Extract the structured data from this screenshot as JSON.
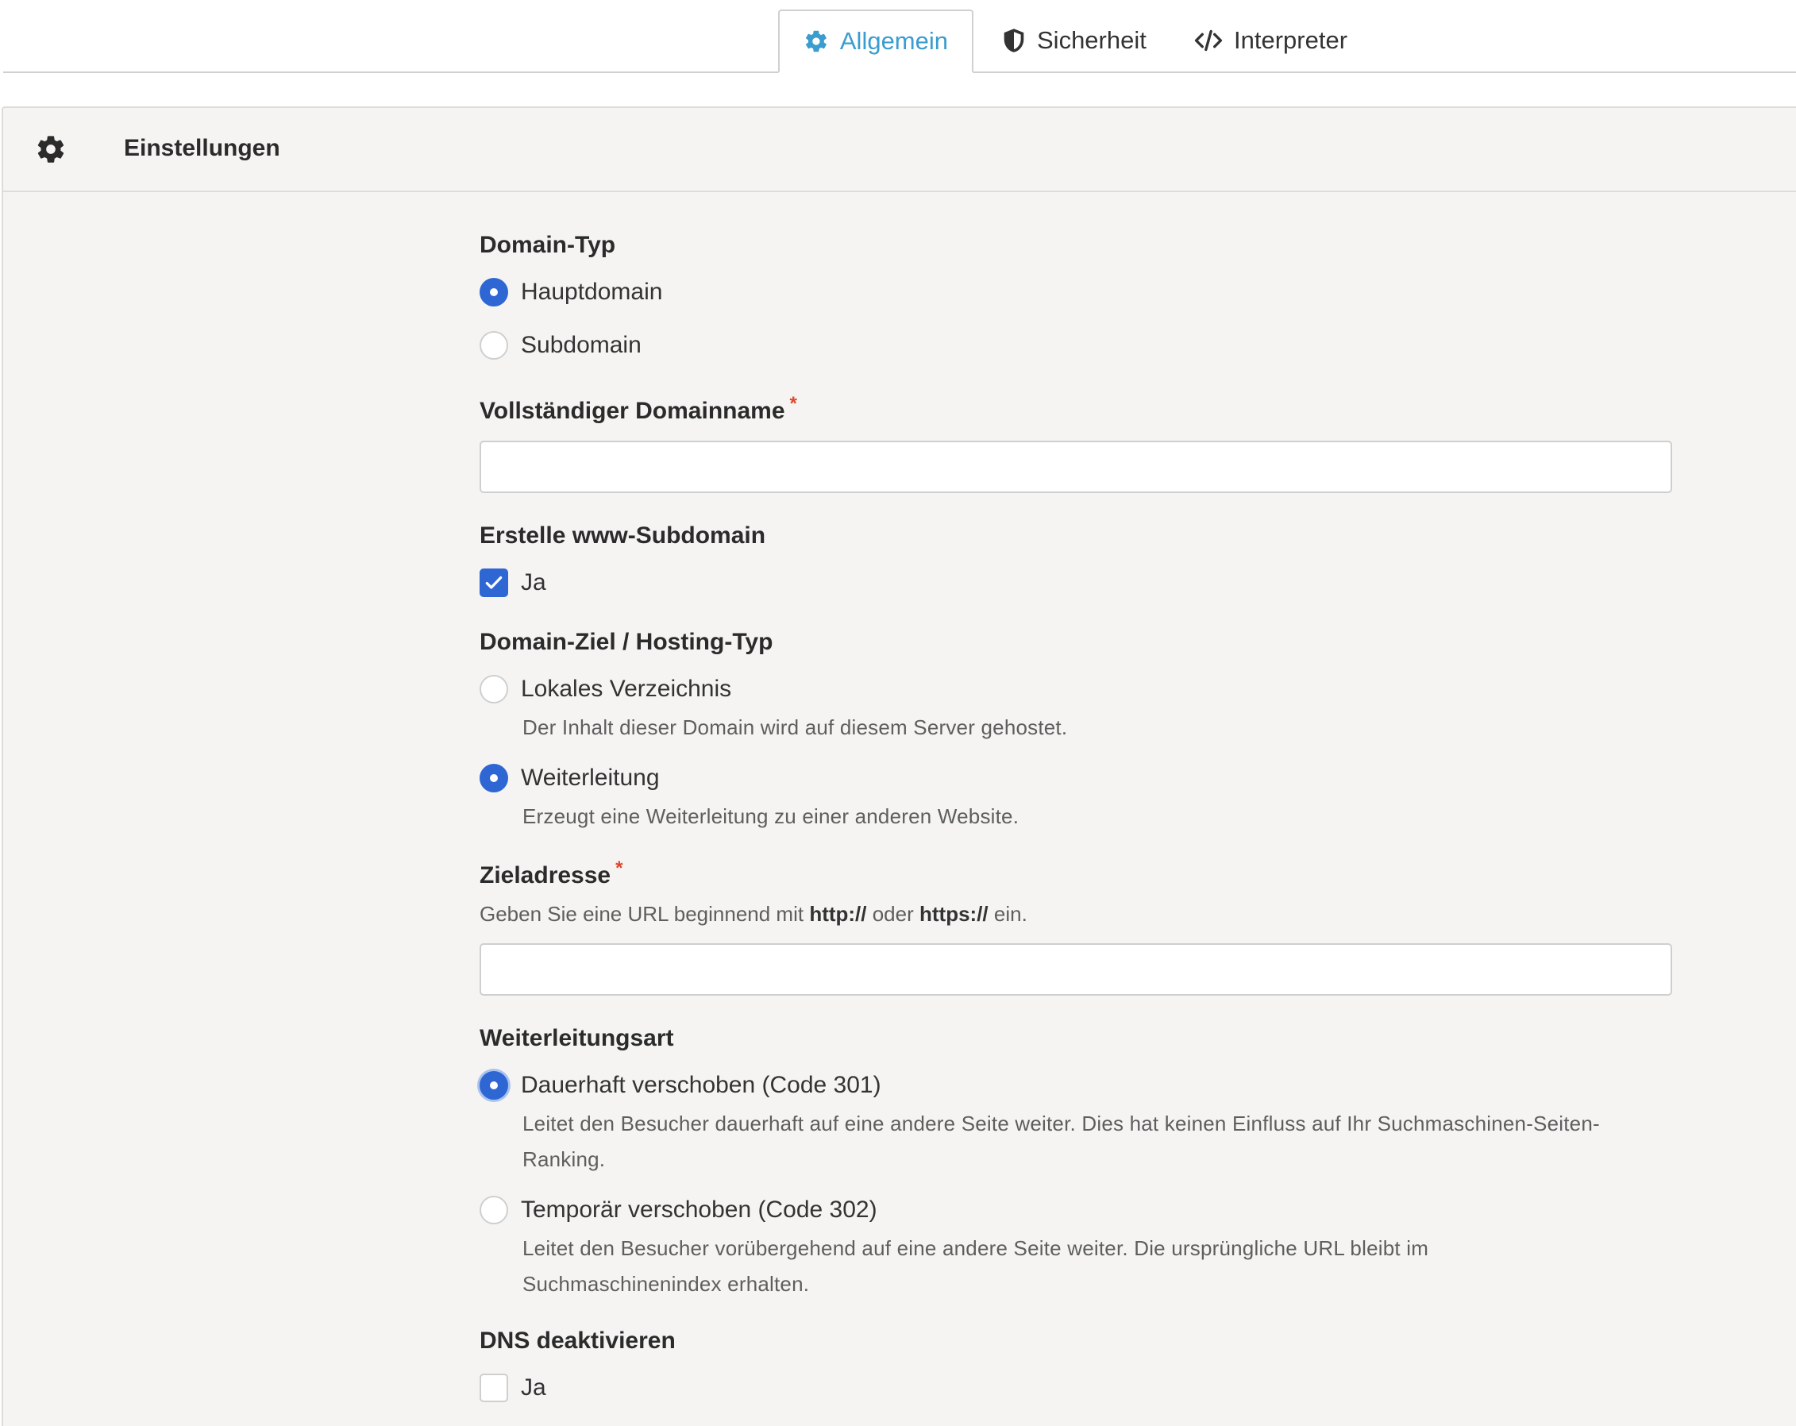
{
  "tabs": [
    {
      "label": "Allgemein",
      "icon": "gear-icon",
      "active": true
    },
    {
      "label": "Sicherheit",
      "icon": "shield-icon",
      "active": false
    },
    {
      "label": "Interpreter",
      "icon": "code-icon",
      "active": false
    }
  ],
  "panel": {
    "title": "Einstellungen",
    "icon": "gear-icon"
  },
  "form": {
    "domain_type": {
      "label": "Domain-Typ",
      "options": [
        {
          "label": "Hauptdomain",
          "selected": true
        },
        {
          "label": "Subdomain",
          "selected": false
        }
      ]
    },
    "fqdn": {
      "label": "Vollständiger Domainname",
      "required_mark": "*",
      "value": ""
    },
    "www": {
      "label": "Erstelle www-Subdomain",
      "option": "Ja",
      "checked": true
    },
    "target": {
      "label": "Domain-Ziel / Hosting-Typ",
      "options": [
        {
          "label": "Lokales Verzeichnis",
          "description": "Der Inhalt dieser Domain wird auf diesem Server gehostet.",
          "selected": false
        },
        {
          "label": "Weiterleitung",
          "description": "Erzeugt eine Weiterleitung zu einer anderen Website.",
          "selected": true
        }
      ]
    },
    "target_address": {
      "label": "Zieladresse",
      "required_mark": "*",
      "hint_prefix": "Geben Sie eine URL beginnend mit ",
      "hint_http": "http://",
      "hint_or": " oder ",
      "hint_https": "https://",
      "hint_suffix": " ein.",
      "value": ""
    },
    "redirect_type": {
      "label": "Weiterleitungsart",
      "options": [
        {
          "label": "Dauerhaft verschoben (Code 301)",
          "description": "Leitet den Besucher dauerhaft auf eine andere Seite weiter. Dies hat keinen Einfluss auf Ihr Suchmaschinen-Seiten-Ranking.",
          "selected": true
        },
        {
          "label": "Temporär verschoben (Code 302)",
          "description": "Leitet den Besucher vorübergehend auf eine andere Seite weiter. Die ursprüngliche URL bleibt im Suchmaschinenindex erhalten.",
          "selected": false
        }
      ]
    },
    "dns": {
      "label": "DNS deaktivieren",
      "option": "Ja",
      "checked": false
    }
  },
  "colors": {
    "accent": "#2e67d4",
    "tab_active": "#3a9ccf",
    "required": "#e0452a",
    "panel_bg": "#f5f4f2"
  }
}
